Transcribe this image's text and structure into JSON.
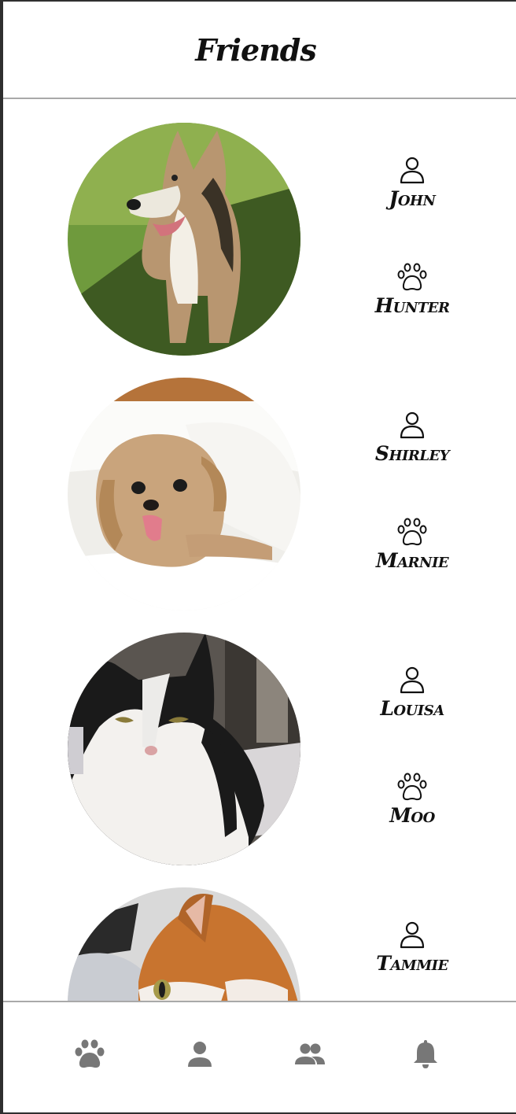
{
  "header": {
    "title": "Friends"
  },
  "friends": [
    {
      "owner": "John",
      "pet": "Hunter"
    },
    {
      "owner": "Shirley",
      "pet": "Marnie"
    },
    {
      "owner": "Louisa",
      "pet": "Moo"
    },
    {
      "owner": "Tammie",
      "pet": ""
    }
  ],
  "icons": {
    "owner": "person-outline-icon",
    "pet": "paw-outline-icon"
  },
  "tabbar": {
    "items": [
      {
        "icon": "paw-icon"
      },
      {
        "icon": "person-icon"
      },
      {
        "icon": "people-icon"
      },
      {
        "icon": "bell-icon"
      }
    ],
    "color": "#777777"
  }
}
